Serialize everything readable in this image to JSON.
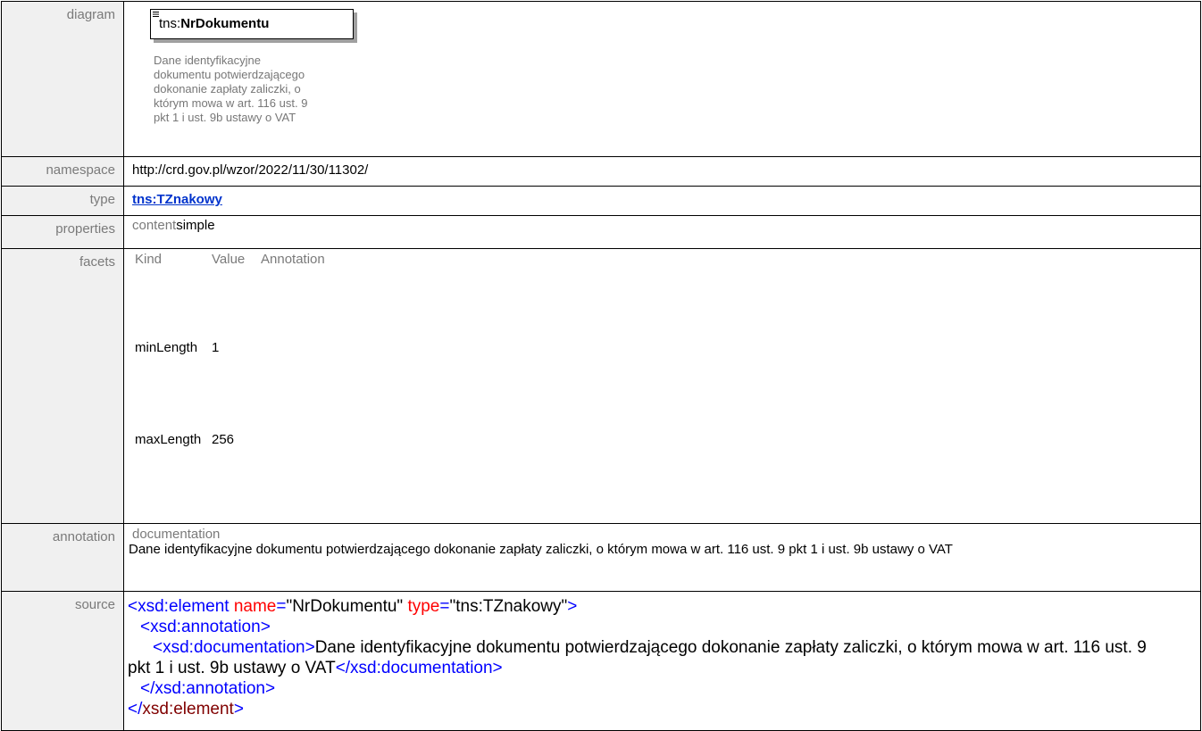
{
  "labels": {
    "diagram": "diagram",
    "namespace": "namespace",
    "type": "type",
    "properties": "properties",
    "facets": "facets",
    "annotation": "annotation",
    "source": "source"
  },
  "diagram": {
    "prefix": "tns:",
    "name": "NrDokumentu",
    "doc_lines": "Dane identyfikacyjne\ndokumentu potwierdzającego\ndokonanie zapłaty zaliczki, o\nktórym mowa w art. 116 ust. 9\npkt 1 i ust. 9b ustawy o VAT"
  },
  "namespace": "http://crd.gov.pl/wzor/2022/11/30/11302/",
  "type": "tns:TZnakowy",
  "properties": {
    "key": "content",
    "value": "simple"
  },
  "facets": {
    "headers": [
      "Kind",
      "Value",
      "Annotation"
    ],
    "rows": [
      {
        "kind": "minLength",
        "value": "1"
      },
      {
        "kind": "maxLength",
        "value": "256"
      }
    ]
  },
  "annotation": {
    "heading": "documentation",
    "text": "Dane identyfikacyjne dokumentu potwierdzającego dokonanie zapłaty zaliczki, o którym mowa w art. 116 ust. 9 pkt 1 i ust. 9b ustawy o VAT"
  },
  "source": {
    "element_open": "<xsd:element",
    "attr_name": "name",
    "eq": "=",
    "name_value": "\"NrDokumentu\"",
    "attr_type": "type",
    "type_value": "\"tns:TZnakowy\"",
    "gt": ">",
    "annotation_open": "<xsd:annotation>",
    "documentation_open": "<xsd:documentation>",
    "documentation_text": "Dane identyfikacyjne dokumentu potwierdzającego dokonanie zapłaty zaliczki, o którym mowa w art. 116 ust. 9 pkt 1 i ust. 9b ustawy o VAT",
    "documentation_close": "</xsd:documentation>",
    "annotation_close": "</xsd:annotation>",
    "element_close_lt": "</",
    "element_close_name": "xsd:element",
    "element_close_gt": ">"
  },
  "colors": {
    "label_bg": "#f0f0f0",
    "label_text": "#7a7a7a",
    "link": "#0033cc",
    "xml_bracket": "#0000ff",
    "xml_element": "#800000",
    "xml_attribute": "#ff0000"
  }
}
